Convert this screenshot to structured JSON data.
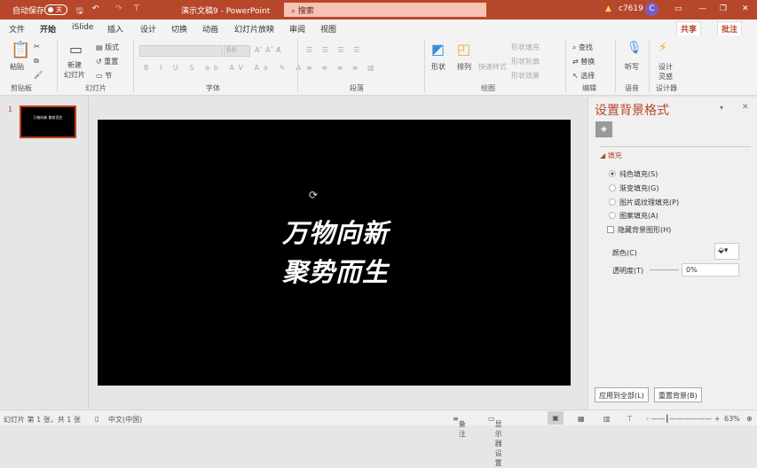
{
  "titlebar": {
    "autosave": "自动保存",
    "autosave_state": "关",
    "doc_title": "演示文稿9 - PowerPoint",
    "search_placeholder": "搜索",
    "user": "c7619",
    "avatar_initial": "C"
  },
  "tabs": [
    "文件",
    "开始",
    "iSlide",
    "插入",
    "设计",
    "切换",
    "动画",
    "幻灯片放映",
    "审阅",
    "视图"
  ],
  "share": "共享",
  "comment": "批注",
  "ribbon": {
    "paste": "粘贴",
    "new_slide": "新建\n幻灯片",
    "layout": "版式",
    "reset": "重置",
    "section": "节",
    "font_size": "66",
    "shape": "形状",
    "arrange": "排列",
    "quick_styles": "快速样式",
    "shape_fill": "形状填充",
    "shape_outline": "形状轮廓",
    "shape_effects": "形状效果",
    "find": "查找",
    "replace": "替换",
    "select": "选择",
    "dictate": "听写",
    "designer_ideas": "设计\n灵感",
    "groups": [
      "剪贴板",
      "幻灯片",
      "字体",
      "段落",
      "绘图",
      "编辑",
      "语音",
      "设计器"
    ]
  },
  "thumbnail": {
    "number": "1",
    "text": "万物向新 聚势而生"
  },
  "slide": {
    "line1": "万物向新",
    "line2": "聚势而生",
    "background": "#000000"
  },
  "panel": {
    "title": "设置背景格式",
    "section": "填充",
    "options": [
      "纯色填充(S)",
      "渐变填充(G)",
      "图片或纹理填充(P)",
      "图案填充(A)"
    ],
    "selected": 0,
    "hide_bg": "隐藏背景图形(H)",
    "color_label": "颜色(C)",
    "transparency_label": "透明度(T)",
    "transparency": "0%",
    "apply_all": "应用到全部(L)",
    "reset_bg": "重置背景(B)"
  },
  "status": {
    "slide_info": "幻灯片 第 1 张，共 1 张",
    "language": "中文(中国)",
    "notes": "备注",
    "display": "显示器设置",
    "zoom": "63%"
  },
  "colors": {
    "accent": "#b7472a"
  }
}
